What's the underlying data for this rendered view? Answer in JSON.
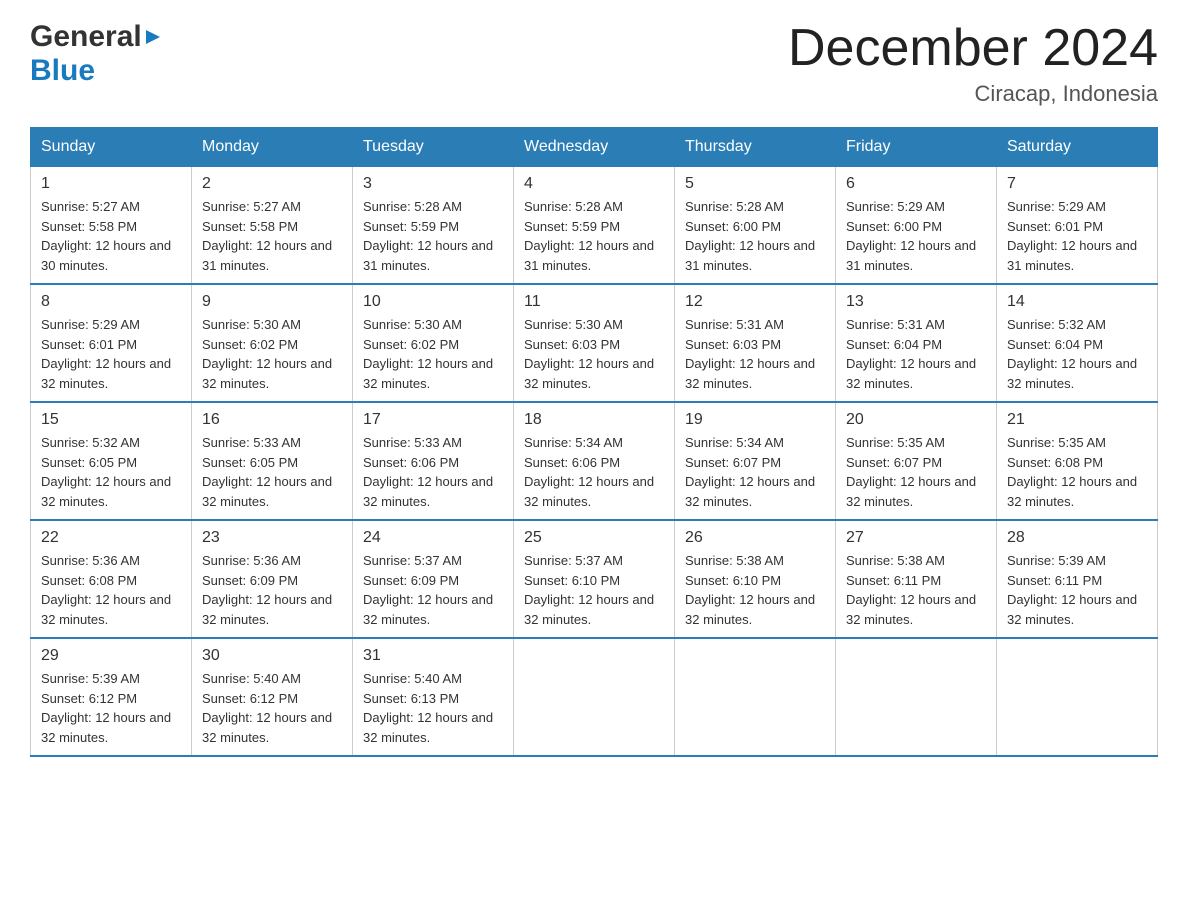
{
  "header": {
    "logo_general": "General",
    "logo_blue": "Blue",
    "month_title": "December 2024",
    "location": "Ciracap, Indonesia"
  },
  "weekdays": [
    "Sunday",
    "Monday",
    "Tuesday",
    "Wednesday",
    "Thursday",
    "Friday",
    "Saturday"
  ],
  "weeks": [
    [
      {
        "day": "1",
        "sunrise": "5:27 AM",
        "sunset": "5:58 PM",
        "daylight": "12 hours and 30 minutes."
      },
      {
        "day": "2",
        "sunrise": "5:27 AM",
        "sunset": "5:58 PM",
        "daylight": "12 hours and 31 minutes."
      },
      {
        "day": "3",
        "sunrise": "5:28 AM",
        "sunset": "5:59 PM",
        "daylight": "12 hours and 31 minutes."
      },
      {
        "day": "4",
        "sunrise": "5:28 AM",
        "sunset": "5:59 PM",
        "daylight": "12 hours and 31 minutes."
      },
      {
        "day": "5",
        "sunrise": "5:28 AM",
        "sunset": "6:00 PM",
        "daylight": "12 hours and 31 minutes."
      },
      {
        "day": "6",
        "sunrise": "5:29 AM",
        "sunset": "6:00 PM",
        "daylight": "12 hours and 31 minutes."
      },
      {
        "day": "7",
        "sunrise": "5:29 AM",
        "sunset": "6:01 PM",
        "daylight": "12 hours and 31 minutes."
      }
    ],
    [
      {
        "day": "8",
        "sunrise": "5:29 AM",
        "sunset": "6:01 PM",
        "daylight": "12 hours and 32 minutes."
      },
      {
        "day": "9",
        "sunrise": "5:30 AM",
        "sunset": "6:02 PM",
        "daylight": "12 hours and 32 minutes."
      },
      {
        "day": "10",
        "sunrise": "5:30 AM",
        "sunset": "6:02 PM",
        "daylight": "12 hours and 32 minutes."
      },
      {
        "day": "11",
        "sunrise": "5:30 AM",
        "sunset": "6:03 PM",
        "daylight": "12 hours and 32 minutes."
      },
      {
        "day": "12",
        "sunrise": "5:31 AM",
        "sunset": "6:03 PM",
        "daylight": "12 hours and 32 minutes."
      },
      {
        "day": "13",
        "sunrise": "5:31 AM",
        "sunset": "6:04 PM",
        "daylight": "12 hours and 32 minutes."
      },
      {
        "day": "14",
        "sunrise": "5:32 AM",
        "sunset": "6:04 PM",
        "daylight": "12 hours and 32 minutes."
      }
    ],
    [
      {
        "day": "15",
        "sunrise": "5:32 AM",
        "sunset": "6:05 PM",
        "daylight": "12 hours and 32 minutes."
      },
      {
        "day": "16",
        "sunrise": "5:33 AM",
        "sunset": "6:05 PM",
        "daylight": "12 hours and 32 minutes."
      },
      {
        "day": "17",
        "sunrise": "5:33 AM",
        "sunset": "6:06 PM",
        "daylight": "12 hours and 32 minutes."
      },
      {
        "day": "18",
        "sunrise": "5:34 AM",
        "sunset": "6:06 PM",
        "daylight": "12 hours and 32 minutes."
      },
      {
        "day": "19",
        "sunrise": "5:34 AM",
        "sunset": "6:07 PM",
        "daylight": "12 hours and 32 minutes."
      },
      {
        "day": "20",
        "sunrise": "5:35 AM",
        "sunset": "6:07 PM",
        "daylight": "12 hours and 32 minutes."
      },
      {
        "day": "21",
        "sunrise": "5:35 AM",
        "sunset": "6:08 PM",
        "daylight": "12 hours and 32 minutes."
      }
    ],
    [
      {
        "day": "22",
        "sunrise": "5:36 AM",
        "sunset": "6:08 PM",
        "daylight": "12 hours and 32 minutes."
      },
      {
        "day": "23",
        "sunrise": "5:36 AM",
        "sunset": "6:09 PM",
        "daylight": "12 hours and 32 minutes."
      },
      {
        "day": "24",
        "sunrise": "5:37 AM",
        "sunset": "6:09 PM",
        "daylight": "12 hours and 32 minutes."
      },
      {
        "day": "25",
        "sunrise": "5:37 AM",
        "sunset": "6:10 PM",
        "daylight": "12 hours and 32 minutes."
      },
      {
        "day": "26",
        "sunrise": "5:38 AM",
        "sunset": "6:10 PM",
        "daylight": "12 hours and 32 minutes."
      },
      {
        "day": "27",
        "sunrise": "5:38 AM",
        "sunset": "6:11 PM",
        "daylight": "12 hours and 32 minutes."
      },
      {
        "day": "28",
        "sunrise": "5:39 AM",
        "sunset": "6:11 PM",
        "daylight": "12 hours and 32 minutes."
      }
    ],
    [
      {
        "day": "29",
        "sunrise": "5:39 AM",
        "sunset": "6:12 PM",
        "daylight": "12 hours and 32 minutes."
      },
      {
        "day": "30",
        "sunrise": "5:40 AM",
        "sunset": "6:12 PM",
        "daylight": "12 hours and 32 minutes."
      },
      {
        "day": "31",
        "sunrise": "5:40 AM",
        "sunset": "6:13 PM",
        "daylight": "12 hours and 32 minutes."
      },
      null,
      null,
      null,
      null
    ]
  ]
}
